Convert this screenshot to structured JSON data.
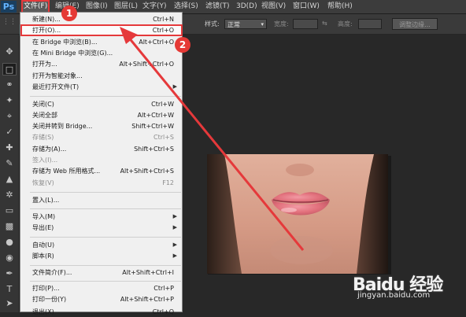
{
  "app": {
    "logo": "Ps"
  },
  "menubar": {
    "items": [
      "文件(F)",
      "编辑(E)",
      "图像(I)",
      "图层(L)",
      "文字(Y)",
      "选择(S)",
      "滤镜(T)",
      "3D(D)",
      "视图(V)",
      "窗口(W)",
      "帮助(H)"
    ]
  },
  "options": {
    "style_label": "样式:",
    "style_value": "正常",
    "width_label": "宽度:",
    "height_label": "高度:",
    "adjust_edge_button": "调整边缘..."
  },
  "file_menu": {
    "items": [
      {
        "label": "新建(N)...",
        "shortcut": "Ctrl+N"
      },
      {
        "label": "打开(O)...",
        "shortcut": "Ctrl+O"
      },
      {
        "label": "在 Bridge 中浏览(B)...",
        "shortcut": "Alt+Ctrl+O"
      },
      {
        "label": "在 Mini Bridge 中浏览(G)...",
        "shortcut": ""
      },
      {
        "label": "打开为...",
        "shortcut": "Alt+Shift+Ctrl+O"
      },
      {
        "label": "打开为智能对象...",
        "shortcut": ""
      },
      {
        "label": "最近打开文件(T)",
        "shortcut": ""
      },
      {
        "label": "关闭(C)",
        "shortcut": "Ctrl+W"
      },
      {
        "label": "关闭全部",
        "shortcut": "Alt+Ctrl+W"
      },
      {
        "label": "关闭并转到 Bridge...",
        "shortcut": "Shift+Ctrl+W"
      },
      {
        "label": "存储(S)",
        "shortcut": "Ctrl+S"
      },
      {
        "label": "存储为(A)...",
        "shortcut": "Shift+Ctrl+S"
      },
      {
        "label": "签入(I)...",
        "shortcut": ""
      },
      {
        "label": "存储为 Web 所用格式...",
        "shortcut": "Alt+Shift+Ctrl+S"
      },
      {
        "label": "恢复(V)",
        "shortcut": "F12"
      },
      {
        "label": "置入(L)...",
        "shortcut": ""
      },
      {
        "label": "导入(M)",
        "shortcut": ""
      },
      {
        "label": "导出(E)",
        "shortcut": ""
      },
      {
        "label": "自动(U)",
        "shortcut": ""
      },
      {
        "label": "脚本(R)",
        "shortcut": ""
      },
      {
        "label": "文件简介(F)...",
        "shortcut": "Alt+Shift+Ctrl+I"
      },
      {
        "label": "打印(P)...",
        "shortcut": "Ctrl+P"
      },
      {
        "label": "打印一份(Y)",
        "shortcut": "Alt+Shift+Ctrl+P"
      },
      {
        "label": "退出(X)",
        "shortcut": "Ctrl+Q"
      }
    ]
  },
  "annotations": {
    "badge1": "1",
    "badge2": "2",
    "color": "#e5393b"
  },
  "watermark": {
    "main": "Baidu 经验",
    "sub": "jingyan.baidu.com"
  }
}
